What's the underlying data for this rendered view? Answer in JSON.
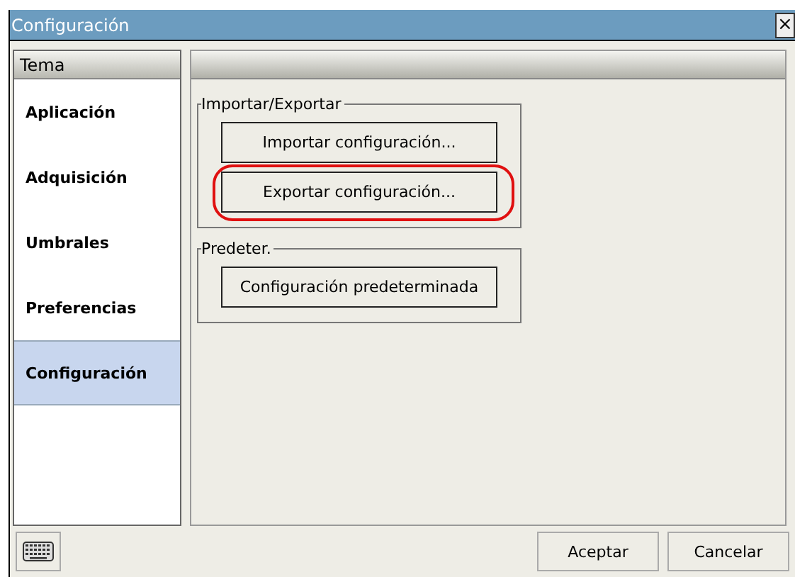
{
  "window": {
    "title": "Configuración",
    "close": "×"
  },
  "sidebar": {
    "header": "Tema",
    "items": [
      {
        "label": "Aplicación",
        "selected": false
      },
      {
        "label": "Adquisición",
        "selected": false
      },
      {
        "label": "Umbrales",
        "selected": false
      },
      {
        "label": "Preferencias",
        "selected": false
      },
      {
        "label": "Configuración",
        "selected": true
      }
    ]
  },
  "groups": [
    {
      "title": "Importar/Exportar",
      "buttons": [
        {
          "label": "Importar configuración...",
          "highlighted": false
        },
        {
          "label": "Exportar configuración...",
          "highlighted": true
        }
      ]
    },
    {
      "title": "Predeter.",
      "buttons": [
        {
          "label": "Configuración predeterminada",
          "highlighted": false
        }
      ]
    }
  ],
  "footer": {
    "buttons": [
      "Aceptar",
      "Cancelar"
    ]
  }
}
